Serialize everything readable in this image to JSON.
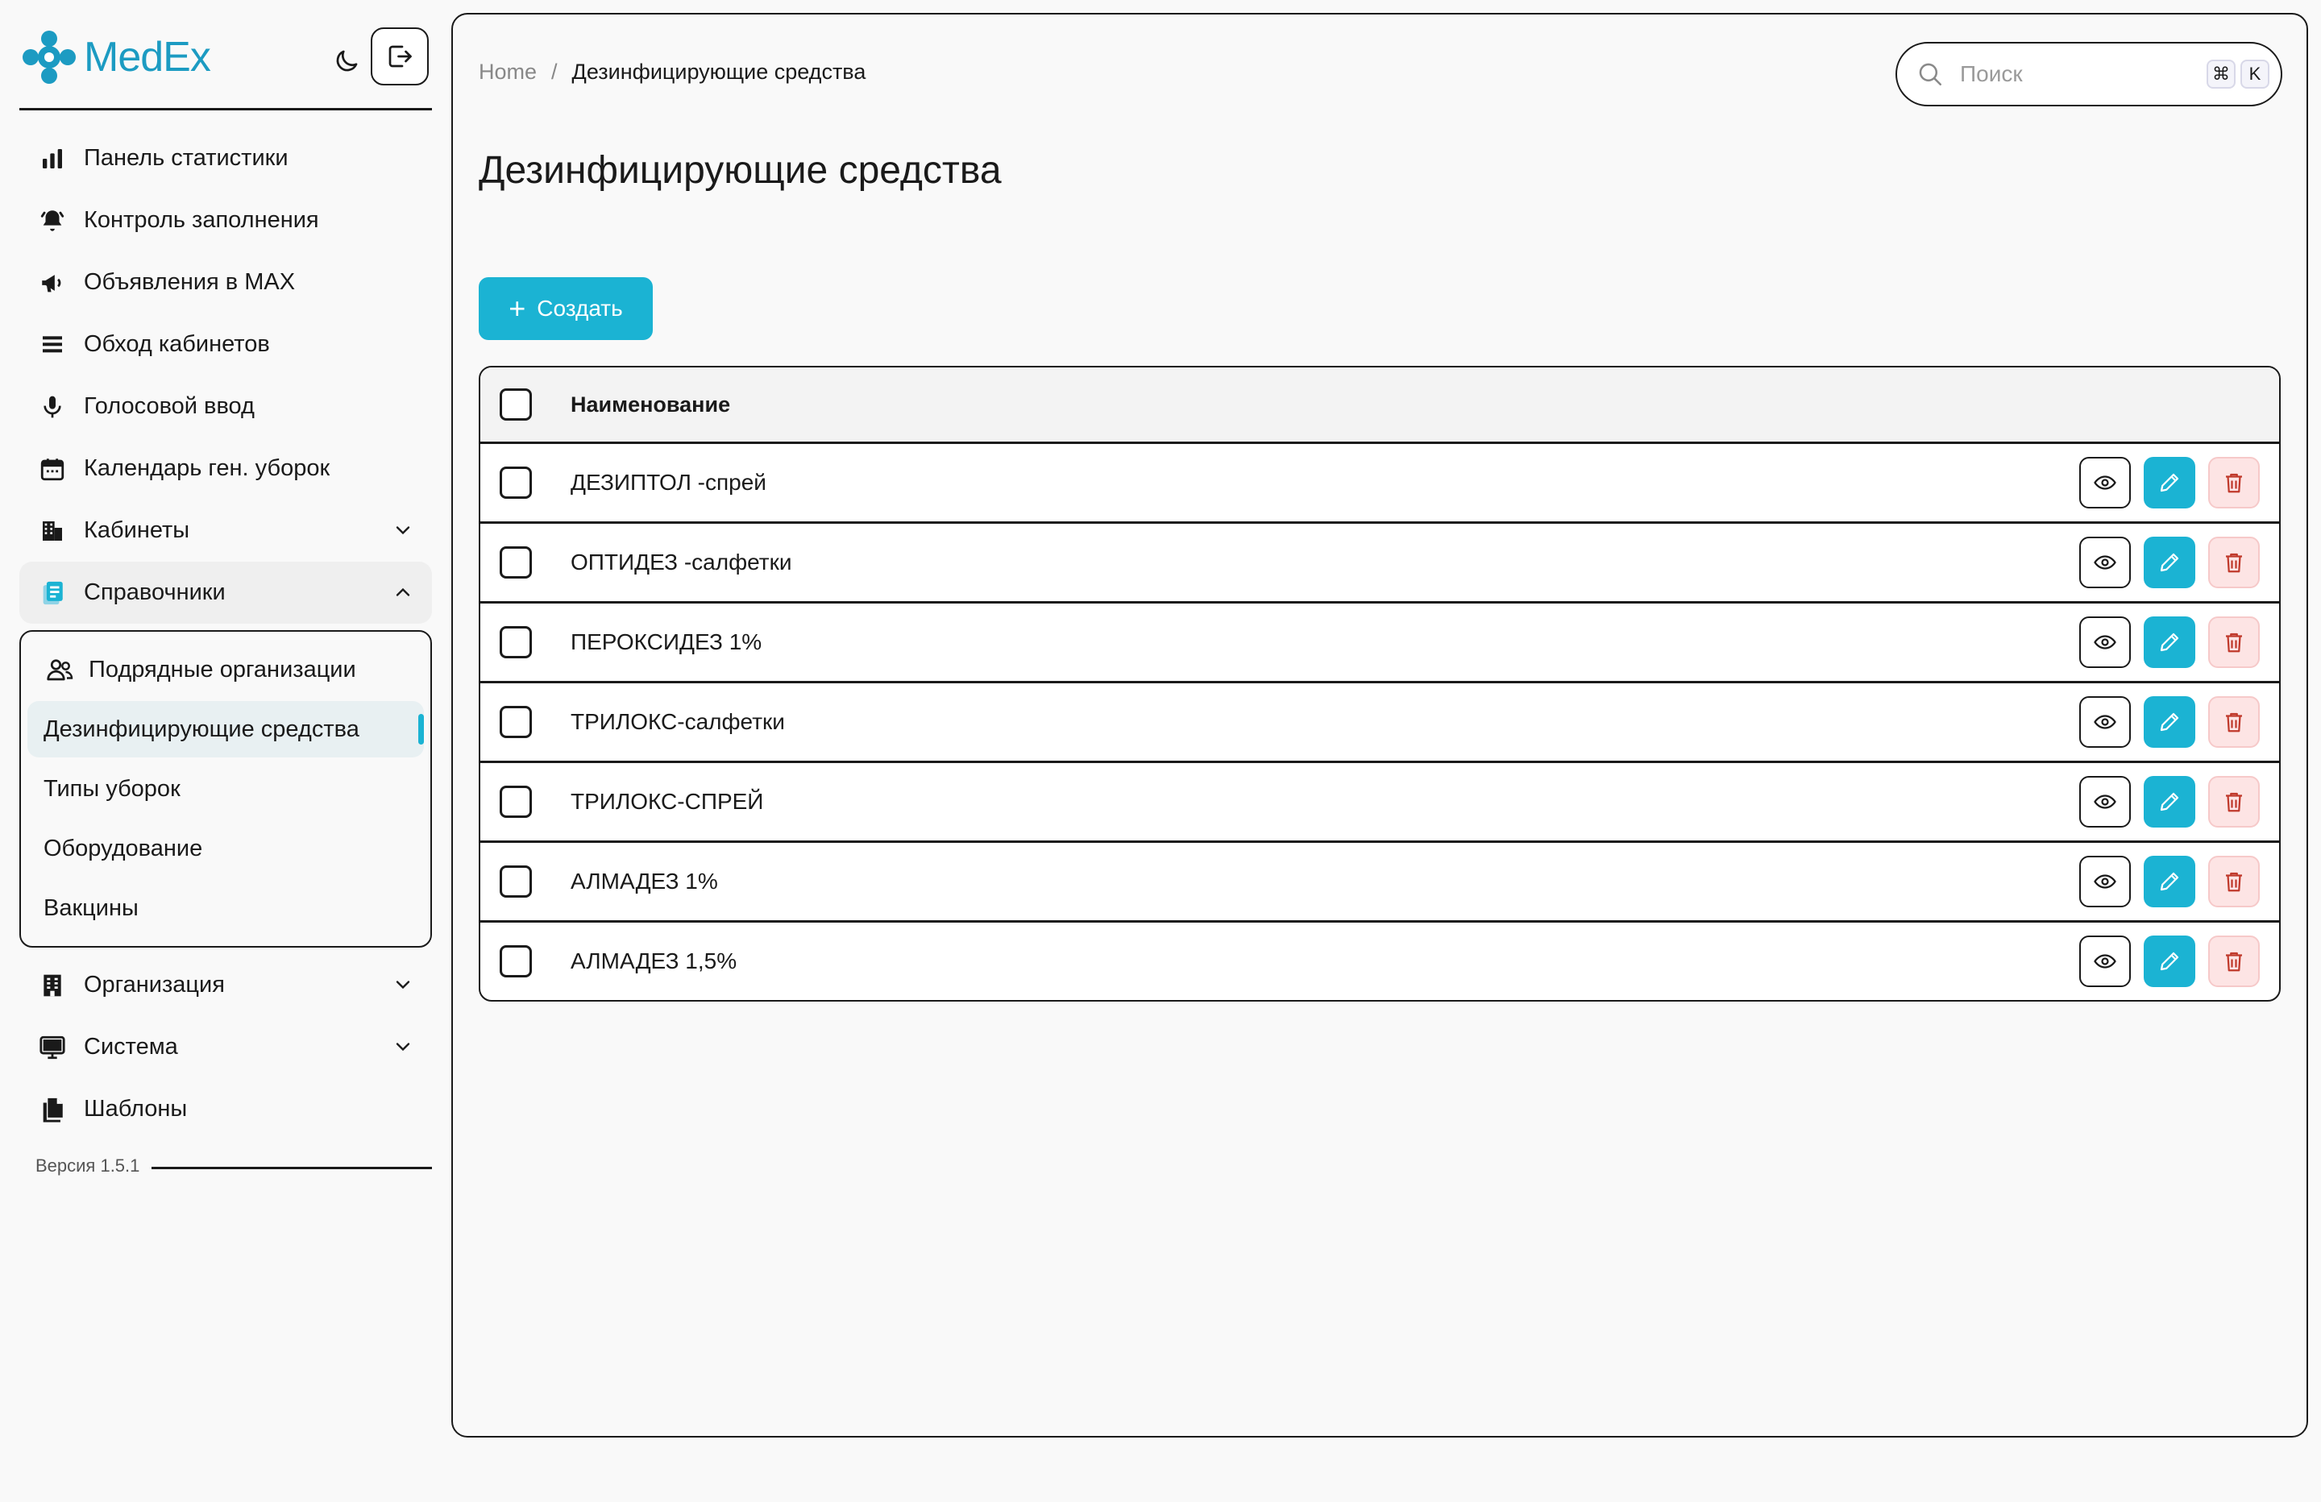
{
  "app": {
    "name": "MedEx",
    "brand_color": "#1c9bc2",
    "accent_color": "#1bb3d3",
    "danger_bg": "#fde4e4"
  },
  "sidebar": {
    "items": [
      {
        "label": "Панель статистики",
        "icon": "bar-chart-icon"
      },
      {
        "label": "Контроль заполнения",
        "icon": "bell-icon"
      },
      {
        "label": "Объявления в MAX",
        "icon": "megaphone-icon"
      },
      {
        "label": "Обход кабинетов",
        "icon": "list-icon"
      },
      {
        "label": "Голосовой ввод",
        "icon": "microphone-icon"
      },
      {
        "label": "Календарь ген. уборок",
        "icon": "calendar-icon"
      },
      {
        "label": "Кабинеты",
        "icon": "building-icon"
      },
      {
        "label": "Справочники",
        "icon": "clipboard-icon"
      }
    ],
    "submenu": [
      {
        "label": "Подрядные организации",
        "icon": "users-icon"
      },
      {
        "label": "Дезинфицирующие средства"
      },
      {
        "label": "Типы уборок"
      },
      {
        "label": "Оборудование"
      },
      {
        "label": "Вакцины"
      }
    ],
    "items_after": [
      {
        "label": "Организация",
        "icon": "office-icon"
      },
      {
        "label": "Система",
        "icon": "monitor-icon"
      },
      {
        "label": "Шаблоны",
        "icon": "documents-icon"
      }
    ],
    "version": "Версия 1.5.1"
  },
  "breadcrumb": {
    "home": "Home",
    "separator": "/",
    "current": "Дезинфицирующие средства"
  },
  "search": {
    "placeholder": "Поиск",
    "shortcut_mod": "⌘",
    "shortcut_key": "K"
  },
  "page": {
    "title": "Дезинфицирующие средства",
    "create_label": "Создать"
  },
  "table": {
    "column_name": "Наименование",
    "rows": [
      "ДЕЗИПТОЛ -спрей",
      "ОПТИДЕЗ -салфетки",
      "ПЕРОКСИДЕЗ 1%",
      "ТРИЛОКС-салфетки",
      "ТРИЛОКС-СПРЕЙ",
      "АЛМАДЕЗ 1%",
      "АЛМАДЕЗ 1,5%"
    ]
  }
}
